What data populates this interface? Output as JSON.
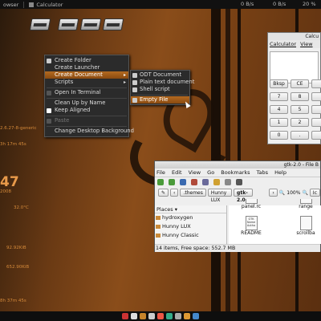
{
  "top_panel": {
    "items": [
      "owser",
      "Calculator"
    ],
    "net_down": "0 B/s",
    "net_up": "0 B/s",
    "volume": "20 %"
  },
  "desktop_menu": {
    "items": [
      {
        "label": "Create Folder"
      },
      {
        "label": "Create Launcher"
      },
      {
        "label": "Create Document",
        "submenu": true,
        "highlighted": true
      },
      {
        "label": "Scripts",
        "submenu": true
      },
      {
        "label": "Open In Terminal"
      },
      {
        "label": "Clean Up by Name"
      },
      {
        "label": "Keep Aligned",
        "checked": true
      },
      {
        "label": "Paste",
        "disabled": true
      },
      {
        "label": "Change Desktop Background"
      }
    ]
  },
  "document_submenu": {
    "items": [
      "ODT Document",
      "Plain text document",
      "Shell script",
      "Empty File"
    ],
    "highlighted": "Empty File"
  },
  "conky": {
    "kernel": "2.6.27-8-generic",
    "uptime": "3h 17m 45s",
    "day": "47",
    "year": "2008",
    "temp": "32.0°C",
    "net1": "92.92KiB",
    "net2": "652.90KiB",
    "time": "8h 37m 45s"
  },
  "calculator": {
    "title": "Calcu",
    "menu": [
      "Calculator",
      "View"
    ],
    "buttons": [
      "Bksp",
      "CE",
      "7",
      "8",
      "4",
      "5",
      "1",
      "2",
      "0",
      "."
    ]
  },
  "file_browser": {
    "title": "gtk-2.0 - File B",
    "menu": [
      "File",
      "Edit",
      "View",
      "Go",
      "Bookmarks",
      "Tabs",
      "Help"
    ],
    "path": [
      ".themes",
      "Hunny LUX",
      "gtk-2.0"
    ],
    "zoom": "100%",
    "sidebar_header": "Places",
    "places": [
      "hydroxygen",
      "Hunny LUX",
      "Hunny Classic"
    ],
    "files": [
      {
        "name": "panel.rc",
        "preview": "style \"panel\" { bg_"
      },
      {
        "name": "range",
        "preview": ""
      },
      {
        "name": "README",
        "preview": "GTK Name Autho"
      },
      {
        "name": "scrollba",
        "preview": ""
      }
    ],
    "status": "14 items, Free space: 552.7 MB"
  }
}
